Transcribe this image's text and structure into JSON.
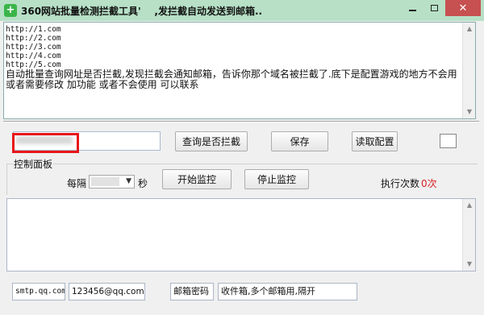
{
  "window": {
    "title": "360网站批量检测拦截工具'    ,发拦截自动发送到邮箱..",
    "app_icon_glyph": "+",
    "minimize_icon": "minimize-icon",
    "maximize_icon": "maximize-icon",
    "close_glyph": "✕"
  },
  "memo": {
    "urls": "http://1.com\nhttp://2.com\nhttp://3.com\nhttp://4.com\nhttp://5.com",
    "description": "自动批量查询网址是否拦截,发现拦截会通知邮箱，告诉你那个域名被拦截了.底下是配置游戏的地方不会用 或者需要修改 加功能 或者不会使用 可以联系"
  },
  "toolbar": {
    "domain_input_value": "",
    "check_button": "查询是否拦截",
    "save_button": "保存",
    "read_config_button": "读取配置"
  },
  "control_panel": {
    "label": "控制面板",
    "every_label": "每隔",
    "interval_value": "",
    "seconds_label": "秒",
    "start_button": "开始监控",
    "stop_button": "停止监控",
    "exec_count_label": "执行次数",
    "exec_count_value": "0次"
  },
  "log": {
    "content": ""
  },
  "mail": {
    "smtp_server": "smtp.qq.com",
    "sender_email": "123456@qq.com",
    "password_placeholder": "邮箱密码",
    "recipients_placeholder": "收件箱,多个邮箱用,隔开"
  },
  "colors": {
    "titlebar": "#b7e0c6",
    "highlight_box": "#e8161a",
    "exec_count": "#d42020",
    "close_button": "#c75050"
  }
}
